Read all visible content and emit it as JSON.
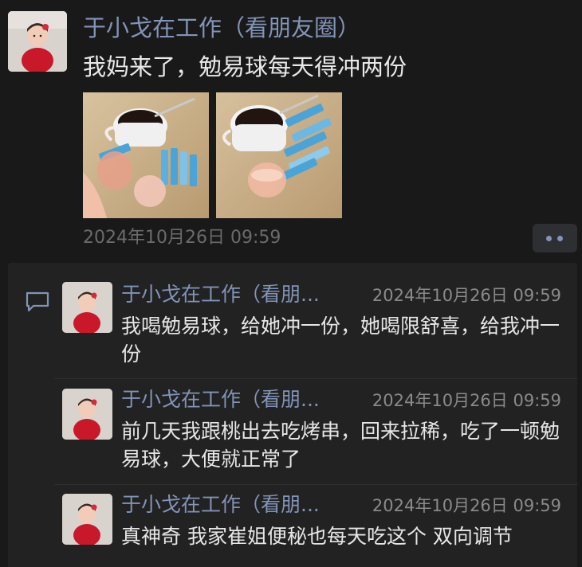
{
  "post": {
    "author": "于小戈在工作（看朋友圈）",
    "text": "我妈来了，勉易球每天得冲两份",
    "time": "2024年10月26日 09:59",
    "photos": [
      "coffee-and-sachets-photo-1",
      "coffee-and-sachets-photo-2"
    ]
  },
  "comments": [
    {
      "author": "于小戈在工作（看朋...",
      "time": "2024年10月26日 09:59",
      "text": "我喝勉易球，给她冲一份，她喝限舒喜，给我冲一份"
    },
    {
      "author": "于小戈在工作（看朋...",
      "time": "2024年10月26日 09:59",
      "text": "前几天我跟桃出去吃烤串，回来拉稀，吃了一顿勉易球，大便就正常了"
    },
    {
      "author": "于小戈在工作（看朋...",
      "time": "2024年10月26日 09:59",
      "text": "真神奇 我家崔姐便秘也每天吃这个 双向调节"
    }
  ],
  "colors": {
    "background": "#191919",
    "panel": "#222222",
    "name": "#8294b8",
    "text": "#e6e6e6",
    "meta": "#8a8a8a"
  },
  "icons": {
    "comment": "comment-bubble-icon",
    "more": "more-dots-icon"
  }
}
